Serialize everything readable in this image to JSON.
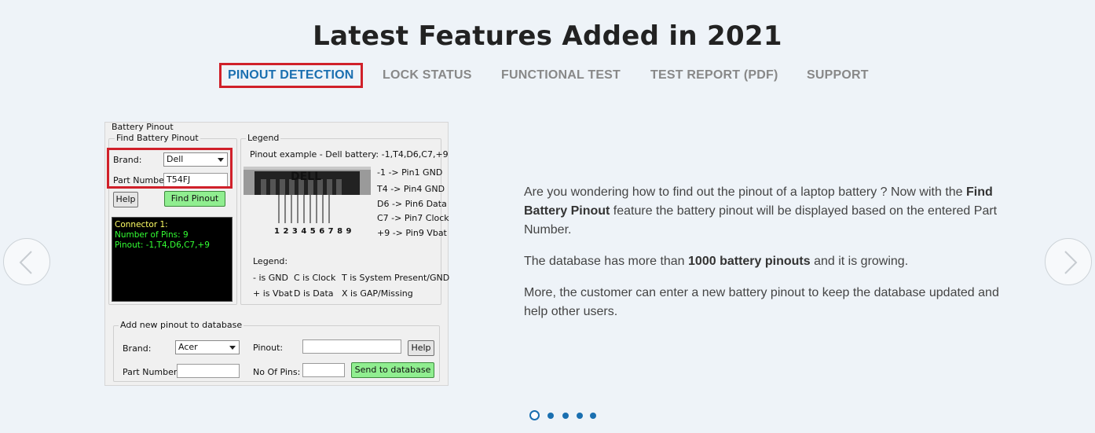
{
  "section_title": "Latest Features Added in 2021",
  "tabs": [
    {
      "label": "PINOUT DETECTION",
      "active": true
    },
    {
      "label": "LOCK STATUS",
      "active": false
    },
    {
      "label": "FUNCTIONAL TEST",
      "active": false
    },
    {
      "label": "TEST REPORT (PDF)",
      "active": false
    },
    {
      "label": "SUPPORT",
      "active": false
    }
  ],
  "carousel": {
    "prev_icon": "chevron-left-icon",
    "next_icon": "chevron-right-icon",
    "slide_count": 5,
    "active_slide": 1
  },
  "app": {
    "window_group": "Battery Pinout",
    "find_group": "Find Battery Pinout",
    "brand_label": "Brand:",
    "brand_value": "Dell",
    "part_label": "Part Number:",
    "part_value": "T54FJ",
    "help_button": "Help",
    "find_button": "Find Pinout",
    "console": {
      "line1": "Connector 1:",
      "line2": "Number of Pins:  9",
      "line3": "Pinout:  -1,T4,D6,C7,+9"
    },
    "legend_group": "Legend",
    "pinout_example": "Pinout example - Dell battery:  -1,T4,D6,C7,+9",
    "battery_brand": "DELL",
    "pin_numbers": "1 2 3 4 5 6 7 8 9",
    "pin_map": [
      "-1 -> Pin1 GND",
      "T4 -> Pin4 GND",
      "D6 -> Pin6 Data",
      "C7 -> Pin7 Clock",
      "+9 -> Pin9 Vbat"
    ],
    "legend_title": "Legend:",
    "legend_items": [
      "- is GND",
      "C is Clock",
      "T is System Present/GND",
      "+ is Vbat",
      "D is Data",
      "X is GAP/Missing"
    ],
    "add_group": "Add new pinout to database",
    "add_brand_label": "Brand:",
    "add_brand_value": "Acer",
    "add_part_label": "Part Number:",
    "add_pinout_label": "Pinout:",
    "add_pins_label": "No Of Pins:",
    "add_help_button": "Help",
    "send_button": "Send to database"
  },
  "description": {
    "p1_pre": "Are you wondering how to find out the pinout of a laptop battery ? Now with the ",
    "p1_bold": "Find Battery Pinout",
    "p1_post": " feature the battery pinout will be displayed based on the entered Part Number.",
    "p2_pre": "The database has more than ",
    "p2_bold": "1000 battery pinouts",
    "p2_post": " and it is growing.",
    "p3": "More, the customer can enter a new battery pinout to keep the database updated and help other users."
  },
  "colors": {
    "accent": "#1a6fb0",
    "highlight": "#d0202a",
    "button_green": "#90ee90",
    "console_yellow": "#ffff66",
    "console_green": "#33ff33"
  }
}
